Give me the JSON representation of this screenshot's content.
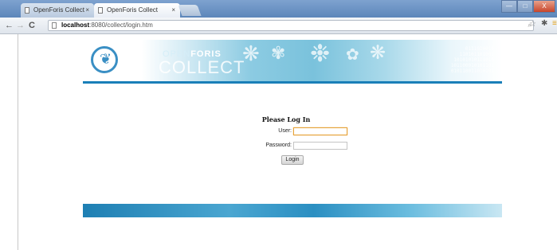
{
  "browser": {
    "tabs": [
      {
        "label": "OpenForis Collect",
        "active": false
      },
      {
        "label": "OpenForis Collect",
        "active": true
      }
    ],
    "close_glyph": "×",
    "address": {
      "host": "localhost",
      "rest": ":8080/collect/login.htm"
    },
    "window_buttons": {
      "minimize": "—",
      "maximize": "□",
      "close": "X"
    }
  },
  "banner": {
    "brand_top_light": "OPEN",
    "brand_top_bold": "FORIS",
    "brand_bottom": "COLLECT",
    "binary_lines": [
      "0111010010",
      "110101101001",
      "10101010111010",
      "101100010101101",
      "010110011010101"
    ]
  },
  "login": {
    "title": "Please Log In",
    "user_label": "User:",
    "user_value": "",
    "password_label": "Password:",
    "password_value": "",
    "button_label": "Login"
  },
  "colors": {
    "accent": "#1a7fb8",
    "focus_border": "#e6a33b"
  }
}
